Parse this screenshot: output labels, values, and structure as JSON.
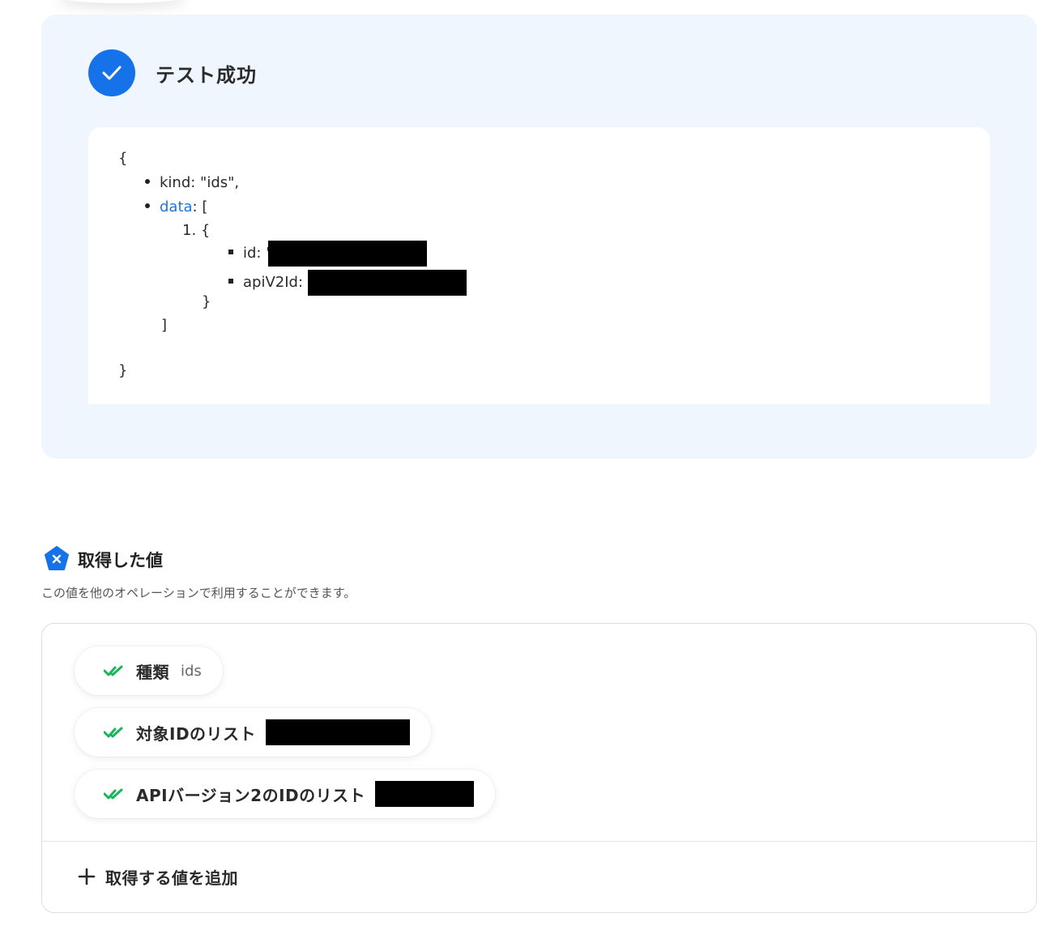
{
  "test_result": {
    "status_title": "テスト成功",
    "json_lines": {
      "open_brace": "{",
      "kind": "kind: \"ids\",",
      "data_key": "data",
      "data_suffix": ": [",
      "item_number": "1. {",
      "id_label": "id: \"",
      "apiV2Id_label": "apiV2Id:",
      "item_close": "}",
      "array_close": "]",
      "close_brace": "}"
    }
  },
  "retrieved_values": {
    "title": "取得した値",
    "description": "この値を他のオペレーションで利用することができます。",
    "items": [
      {
        "label": "種類",
        "value": "ids"
      },
      {
        "label": "対象IDのリスト",
        "value": ""
      },
      {
        "label": "APIバージョン2のIDのリスト",
        "value": ""
      }
    ],
    "add_label": "取得する値を追加"
  },
  "colors": {
    "accent": "#1672e8",
    "panel_bg": "#eff6fe",
    "check_green": "#1bb55c",
    "link": "#1f74e0"
  },
  "icons": {
    "success": "check-circle-icon",
    "section": "variable-badge-icon",
    "chip": "double-check-icon",
    "add": "plus-icon"
  }
}
